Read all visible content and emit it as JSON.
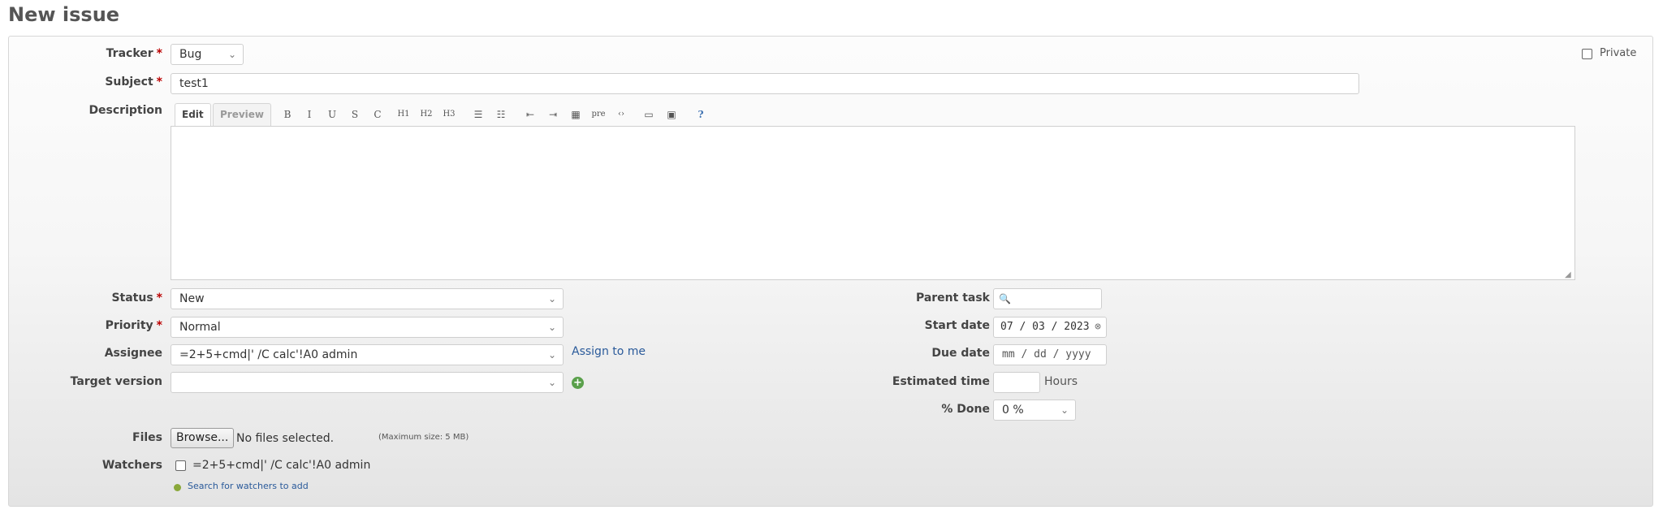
{
  "page": {
    "title": "New issue"
  },
  "tracker": {
    "label": "Tracker",
    "value": "Bug"
  },
  "private": {
    "label": "Private"
  },
  "subject": {
    "label": "Subject",
    "value": "test1"
  },
  "description": {
    "label": "Description",
    "tabs": [
      "Edit",
      "Preview"
    ],
    "toolbar": [
      {
        "glyph": "B",
        "icon": "bold-icon"
      },
      {
        "glyph": "I",
        "icon": "italic-icon"
      },
      {
        "glyph": "U",
        "icon": "underline-icon"
      },
      {
        "glyph": "S",
        "icon": "strikethrough-icon"
      },
      {
        "glyph": "C",
        "icon": "inline-code-icon"
      },
      {
        "glyph": "H1",
        "icon": "heading-1-icon"
      },
      {
        "glyph": "H2",
        "icon": "heading-2-icon"
      },
      {
        "glyph": "H3",
        "icon": "heading-3-icon"
      },
      {
        "glyph": "☰",
        "icon": "unordered-list-icon"
      },
      {
        "glyph": "☷",
        "icon": "ordered-list-icon"
      },
      {
        "glyph": "⇤",
        "icon": "quote-icon"
      },
      {
        "glyph": "⇥",
        "icon": "unquote-icon"
      },
      {
        "glyph": "▦",
        "icon": "table-icon"
      },
      {
        "glyph": "pre",
        "icon": "preformatted-icon"
      },
      {
        "glyph": "‹›",
        "icon": "code-highlight-icon"
      },
      {
        "glyph": "▭",
        "icon": "link-icon"
      },
      {
        "glyph": "▣",
        "icon": "image-icon"
      },
      {
        "glyph": "?",
        "icon": "help-icon"
      }
    ]
  },
  "status": {
    "label": "Status",
    "value": "New"
  },
  "priority": {
    "label": "Priority",
    "value": "Normal"
  },
  "assignee": {
    "label": "Assignee",
    "value": "=2+5+cmd|' /C calc'!A0 admin",
    "assign_to_me": "Assign to me"
  },
  "target_version": {
    "label": "Target version",
    "value": ""
  },
  "parent_task": {
    "label": "Parent task",
    "value": ""
  },
  "start_date": {
    "label": "Start date",
    "value": "07 / 03 / 2023"
  },
  "due_date": {
    "label": "Due date",
    "value": "mm / dd / yyyy"
  },
  "estimated_time": {
    "label": "Estimated time",
    "value": "",
    "unit": "Hours"
  },
  "done": {
    "label": "% Done",
    "value": "0 %"
  },
  "files": {
    "label": "Files",
    "browse": "Browse...",
    "status": "No files selected.",
    "max_size": "(Maximum size: 5 MB)"
  },
  "watchers": {
    "label": "Watchers",
    "user": "=2+5+cmd|' /C calc'!A0 admin",
    "search_link": "Search for watchers to add"
  },
  "colors": {
    "required": "#bb0000",
    "link": "#2a5a9a",
    "add": "#5aa04b"
  }
}
